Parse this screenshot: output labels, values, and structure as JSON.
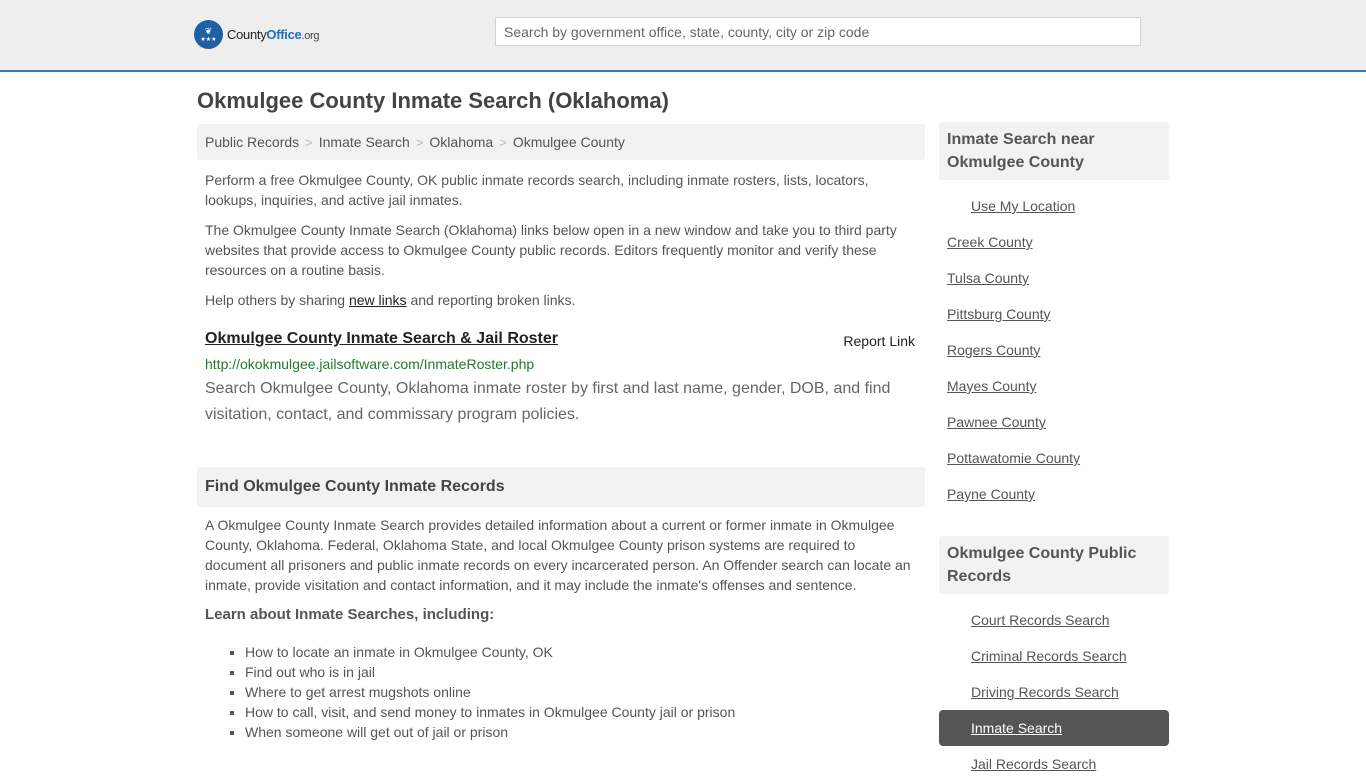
{
  "header": {
    "logo": {
      "county": "County",
      "office": "Office",
      "org": ".org"
    },
    "search_placeholder": "Search by government office, state, county, city or zip code",
    "accent_color": "#337ab7"
  },
  "page_title": "Okmulgee County Inmate Search (Oklahoma)",
  "breadcrumb": [
    "Public Records",
    "Inmate Search",
    "Oklahoma",
    "Okmulgee County"
  ],
  "intro": {
    "p1": "Perform a free Okmulgee County, OK public inmate records search, including inmate rosters, lists, locators, lookups, inquiries, and active jail inmates.",
    "p2": "The Okmulgee County Inmate Search (Oklahoma) links below open in a new window and take you to third party websites that provide access to Okmulgee County public records. Editors frequently monitor and verify these resources on a routine basis.",
    "p3_before": "Help others by sharing ",
    "p3_link": "new links",
    "p3_after": " and reporting broken links."
  },
  "result": {
    "title": "Okmulgee County Inmate Search & Jail Roster",
    "report_label": "Report Link",
    "url": "http://okokmulgee.jailsoftware.com/InmateRoster.php",
    "description": "Search Okmulgee County, Oklahoma inmate roster by first and last name, gender, DOB, and find visitation, contact, and commissary program policies."
  },
  "find_section": {
    "heading": "Find Okmulgee County Inmate Records",
    "body": "A Okmulgee County Inmate Search provides detailed information about a current or former inmate in Okmulgee County, Oklahoma. Federal, Oklahoma State, and local Okmulgee County prison systems are required to document all prisoners and public inmate records on every incarcerated person. An Offender search can locate an inmate, provide visitation and contact information, and it may include the inmate's offenses and sentence.",
    "learn_heading": "Learn about Inmate Searches, including:",
    "learn_items": [
      "How to locate an inmate in Okmulgee County, OK",
      "Find out who is in jail",
      "Where to get arrest mugshots online",
      "How to call, visit, and send money to inmates in Okmulgee County jail or prison",
      "When someone will get out of jail or prison"
    ]
  },
  "sidebar": {
    "nearby": {
      "heading": "Inmate Search near Okmulgee County",
      "use_location": "Use My Location",
      "counties": [
        "Creek County",
        "Tulsa County",
        "Pittsburg County",
        "Rogers County",
        "Mayes County",
        "Pawnee County",
        "Pottawatomie County",
        "Payne County"
      ]
    },
    "public_records": {
      "heading": "Okmulgee County Public Records",
      "items": [
        "Court Records Search",
        "Criminal Records Search",
        "Driving Records Search",
        "Inmate Search",
        "Jail Records Search"
      ],
      "active": "Inmate Search"
    }
  }
}
